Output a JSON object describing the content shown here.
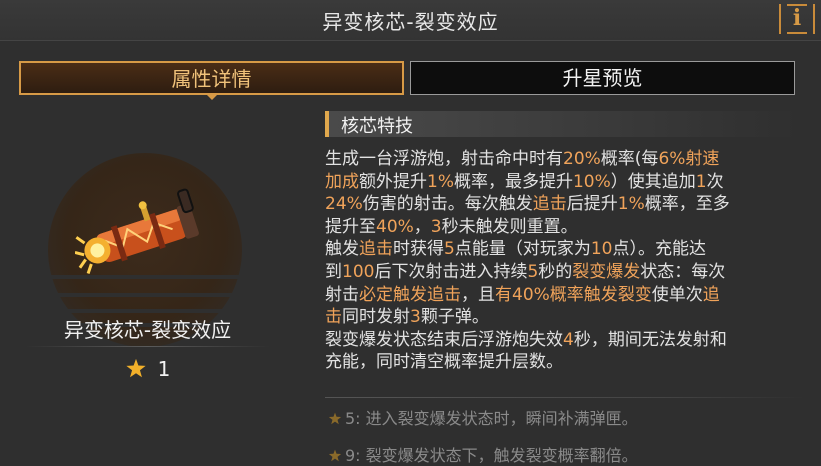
{
  "header": {
    "title": "异变核芯-裂变效应",
    "info_glyph": "i"
  },
  "tabs": [
    {
      "label": "属性详情",
      "active": true
    },
    {
      "label": "升星预览",
      "active": false
    }
  ],
  "core": {
    "name": "异变核芯-裂变效应",
    "stars": "1",
    "item_icon": "floating-cannon-icon"
  },
  "skill": {
    "heading": "核芯特技",
    "lines": [
      [
        {
          "t": "生成一台浮游炮，射击命中时有"
        },
        {
          "t": "20%",
          "h": 1
        },
        {
          "t": "概率(每"
        },
        {
          "t": "6%射速",
          "h": 1
        }
      ],
      [
        {
          "t": "加成",
          "h": 1
        },
        {
          "t": "额外提升"
        },
        {
          "t": "1%",
          "h": 1
        },
        {
          "t": "概率，最多提升"
        },
        {
          "t": "10%",
          "h": 1
        },
        {
          "t": "）使其追加"
        },
        {
          "t": "1",
          "h": 1
        },
        {
          "t": "次"
        }
      ],
      [
        {
          "t": "24%",
          "h": 1
        },
        {
          "t": "伤害的射击。每次触发"
        },
        {
          "t": "追击",
          "h": 1
        },
        {
          "t": "后提升"
        },
        {
          "t": "1%",
          "h": 1
        },
        {
          "t": "概率，至多"
        }
      ],
      [
        {
          "t": "提升至"
        },
        {
          "t": "40%",
          "h": 1
        },
        {
          "t": "，"
        },
        {
          "t": "3",
          "h": 1
        },
        {
          "t": "秒未触发则重置。"
        }
      ],
      [
        {
          "t": "触发"
        },
        {
          "t": "追击",
          "h": 1
        },
        {
          "t": "时获得"
        },
        {
          "t": "5",
          "h": 1
        },
        {
          "t": "点能量（对玩家为"
        },
        {
          "t": "10",
          "h": 1
        },
        {
          "t": "点）。充能达"
        }
      ],
      [
        {
          "t": "到"
        },
        {
          "t": "100",
          "h": 1
        },
        {
          "t": "后下次射击进入持续"
        },
        {
          "t": "5",
          "h": 1
        },
        {
          "t": "秒的"
        },
        {
          "t": "裂变爆发",
          "h": 1
        },
        {
          "t": "状态：每次"
        }
      ],
      [
        {
          "t": "射击"
        },
        {
          "t": "必定触发追击",
          "h": 1
        },
        {
          "t": "，且"
        },
        {
          "t": "有40%概率触发裂变",
          "h": 1
        },
        {
          "t": "使单次"
        },
        {
          "t": "追",
          "h": 1
        }
      ],
      [
        {
          "t": "击",
          "h": 1
        },
        {
          "t": "同时发射"
        },
        {
          "t": "3",
          "h": 1
        },
        {
          "t": "颗子弹。"
        }
      ],
      [
        {
          "t": "裂变爆发状态结束后浮游炮失效"
        },
        {
          "t": "4",
          "h": 1
        },
        {
          "t": "秒，期间无法发射和"
        }
      ],
      [
        {
          "t": "充能，同时清空概率提升层数。"
        }
      ]
    ]
  },
  "star_notes": [
    {
      "text": "5: 进入裂变爆发状态时，瞬间补满弹匣。"
    },
    {
      "text": "9: 裂变爆发状态下，触发裂变概率翻倍。"
    }
  ],
  "colors": {
    "accent": "#d79a46",
    "highlight": "#f0a35a",
    "star": "#f2b02a",
    "dim_star": "#8a6a2a"
  }
}
